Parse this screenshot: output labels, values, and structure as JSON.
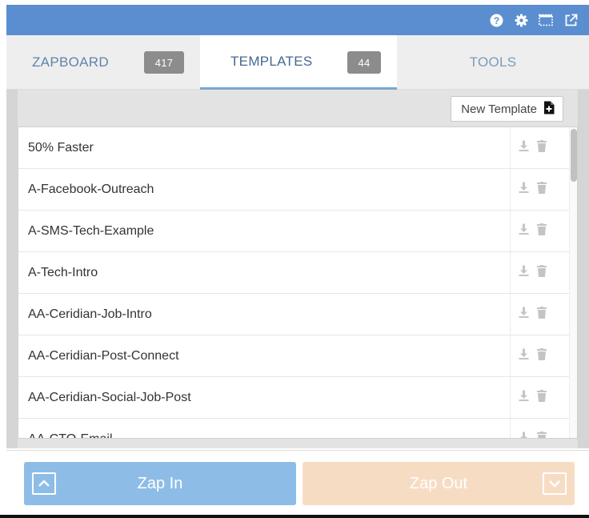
{
  "tabs": [
    {
      "label": "ZAPBOARD",
      "badge": "417"
    },
    {
      "label": "TEMPLATES",
      "badge": "44"
    },
    {
      "label": "TOOLS"
    }
  ],
  "toolbar": {
    "new_template_label": "New Template"
  },
  "templates": [
    {
      "name": "50% Faster"
    },
    {
      "name": "A-Facebook-Outreach"
    },
    {
      "name": "A-SMS-Tech-Example"
    },
    {
      "name": "A-Tech-Intro"
    },
    {
      "name": "AA-Ceridian-Job-Intro"
    },
    {
      "name": "AA-Ceridian-Post-Connect"
    },
    {
      "name": "AA-Ceridian-Social-Job-Post"
    },
    {
      "name": "AA-CTO-Email"
    }
  ],
  "footer": {
    "zap_in_label": "Zap In",
    "zap_out_label": "Zap Out"
  },
  "icons": [
    "help-icon",
    "gear-icon",
    "fullscreen-icon",
    "external-link-icon",
    "new-file-icon",
    "download-icon",
    "trash-icon",
    "chevron-up-icon",
    "chevron-down-icon"
  ],
  "colors": {
    "topbar": "#5b8ed0",
    "zap_in": "#8dbde6",
    "zap_out": "#f7dcc4",
    "tab_active_border": "#7aa6d6"
  }
}
